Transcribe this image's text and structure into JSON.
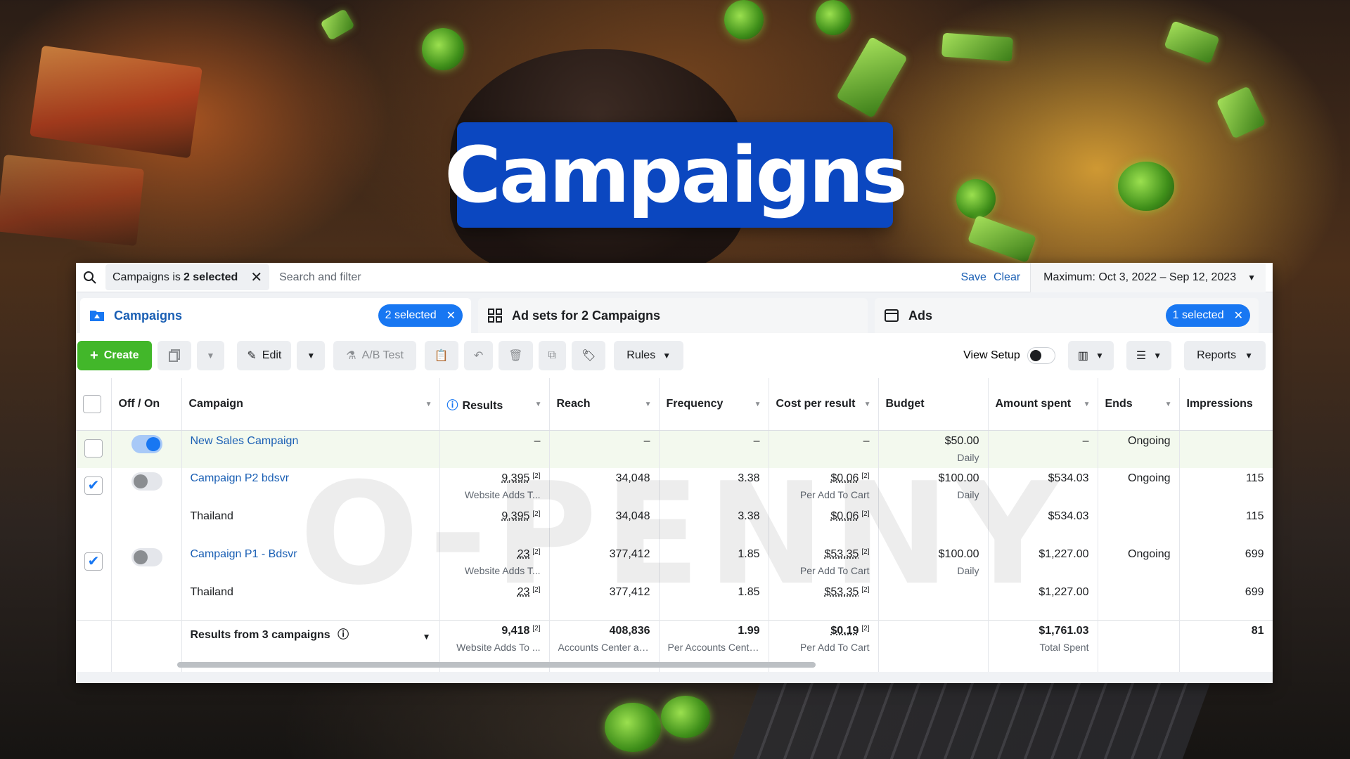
{
  "banner": {
    "title": "Campaigns"
  },
  "search": {
    "filter_label": "Campaigns is",
    "filter_value": "2 selected",
    "placeholder": "Search and filter",
    "save_label": "Save",
    "clear_label": "Clear",
    "date_range": "Maximum: Oct 3, 2022 – Sep 12, 2023"
  },
  "tabs": {
    "campaigns": {
      "label": "Campaigns",
      "selected": "2 selected"
    },
    "adsets": {
      "label": "Ad sets for 2 Campaigns"
    },
    "ads": {
      "label": "Ads",
      "selected": "1 selected"
    }
  },
  "toolbar": {
    "create_label": "Create",
    "edit_label": "Edit",
    "ab_test_label": "A/B Test",
    "rules_label": "Rules",
    "view_setup_label": "View Setup",
    "reports_label": "Reports"
  },
  "columns": [
    "Off / On",
    "Campaign",
    "Results",
    "Reach",
    "Frequency",
    "Cost per result",
    "Budget",
    "Amount spent",
    "Ends",
    "Impressions"
  ],
  "rows": [
    {
      "campaign": "New Sales Campaign",
      "results": "–",
      "reach": "–",
      "frequency": "–",
      "cpr": "–",
      "budget": "$50.00",
      "budget_sub": "Daily",
      "spent": "–",
      "ends": "Ongoing",
      "impressions": ""
    },
    {
      "campaign": "Campaign P2 bdsvr",
      "results": "9,395",
      "results_sub": "Website Adds T...",
      "reach": "34,048",
      "frequency": "3.38",
      "cpr": "$0.06",
      "cpr_sub": "Per Add To Cart",
      "budget": "$100.00",
      "budget_sub": "Daily",
      "spent": "$534.03",
      "ends": "Ongoing",
      "impressions": "115"
    },
    {
      "campaign": "Thailand",
      "results": "9,395",
      "reach": "34,048",
      "frequency": "3.38",
      "cpr": "$0.06",
      "spent": "$534.03",
      "impressions": "115"
    },
    {
      "campaign": "Campaign P1 - Bdsvr",
      "results": "23",
      "results_sub": "Website Adds T...",
      "reach": "377,412",
      "frequency": "1.85",
      "cpr": "$53.35",
      "cpr_sub": "Per Add To Cart",
      "budget": "$100.00",
      "budget_sub": "Daily",
      "spent": "$1,227.00",
      "ends": "Ongoing",
      "impressions": "699"
    },
    {
      "campaign": "Thailand",
      "results": "23",
      "reach": "377,412",
      "frequency": "1.85",
      "cpr": "$53.35",
      "spent": "$1,227.00",
      "impressions": "699"
    }
  ],
  "totals": {
    "label": "Results from 3 campaigns",
    "results": "9,418",
    "results_sub": "Website Adds To ...",
    "reach": "408,836",
    "reach_sub": "Accounts Center ac...",
    "frequency": "1.99",
    "frequency_sub": "Per Accounts Cente...",
    "cpr": "$0.19",
    "cpr_sub": "Per Add To Cart",
    "spent": "$1,761.03",
    "spent_sub": "Total Spent",
    "impressions": "81"
  },
  "ref_mark": "[2]",
  "watermark": "O-PENNY"
}
